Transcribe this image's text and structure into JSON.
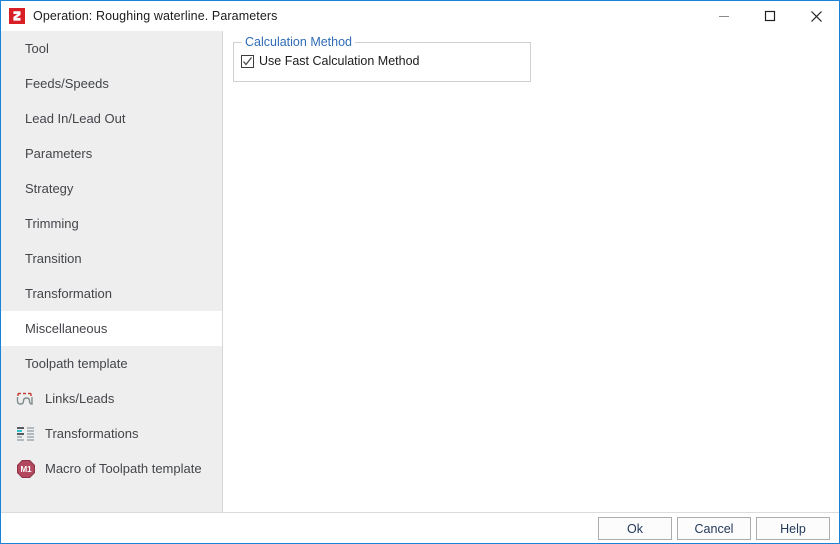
{
  "window": {
    "title": "Operation: Roughing waterline. Parameters",
    "app_icon": "sprut-logo-icon",
    "accent_border_color": "#1883d7",
    "controls": [
      {
        "name": "minimize",
        "glyph": "minimize-icon"
      },
      {
        "name": "maximize",
        "glyph": "maximize-icon"
      },
      {
        "name": "close",
        "glyph": "close-icon"
      }
    ]
  },
  "sidebar": {
    "background_color": "#eeeeee",
    "items": [
      {
        "label": "Tool",
        "icon": null,
        "selected": false
      },
      {
        "label": "Feeds/Speeds",
        "icon": null,
        "selected": false
      },
      {
        "label": "Lead In/Lead Out",
        "icon": null,
        "selected": false
      },
      {
        "label": "Parameters",
        "icon": null,
        "selected": false
      },
      {
        "label": "Strategy",
        "icon": null,
        "selected": false
      },
      {
        "label": "Trimming",
        "icon": null,
        "selected": false
      },
      {
        "label": "Transition",
        "icon": null,
        "selected": false
      },
      {
        "label": "Transformation",
        "icon": null,
        "selected": false
      },
      {
        "label": "Miscellaneous",
        "icon": null,
        "selected": true
      },
      {
        "label": "Toolpath template",
        "icon": null,
        "selected": false
      },
      {
        "label": "Links/Leads",
        "icon": "links-leads-icon",
        "selected": false
      },
      {
        "label": "Transformations",
        "icon": "transformations-icon",
        "selected": false
      },
      {
        "label": "Macro of Toolpath template",
        "icon": "macro-m1-icon",
        "selected": false
      }
    ]
  },
  "main": {
    "group": {
      "title": "Calculation Method",
      "title_color": "#2f6cb5",
      "checkbox": {
        "label": "Use Fast Calculation Method",
        "checked": true
      }
    }
  },
  "footer": {
    "buttons": [
      {
        "label": "Ok",
        "name": "ok-button"
      },
      {
        "label": "Cancel",
        "name": "cancel-button"
      },
      {
        "label": "Help",
        "name": "help-button"
      }
    ]
  }
}
